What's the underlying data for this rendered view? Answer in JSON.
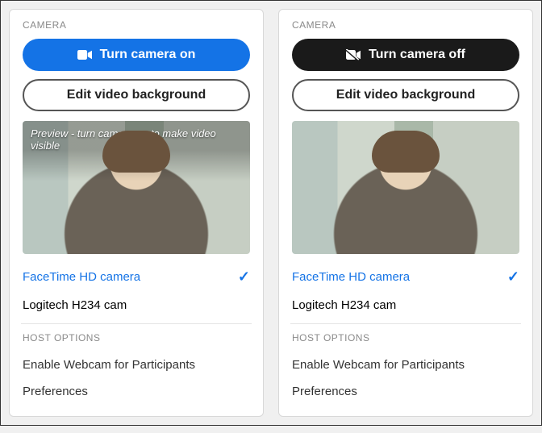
{
  "left": {
    "section_label": "CAMERA",
    "toggle_label": "Turn camera on",
    "toggle_style": "blue",
    "toggle_icon": "camera",
    "edit_bg_label": "Edit video background",
    "preview_caption": "Preview -  turn camera on to make video visible",
    "devices": [
      {
        "name": "FaceTime HD camera",
        "selected": true
      },
      {
        "name": "Logitech H234 cam",
        "selected": false
      }
    ],
    "host_section_label": "HOST OPTIONS",
    "host_options": [
      "Enable Webcam for Participants",
      "Preferences"
    ]
  },
  "right": {
    "section_label": "CAMERA",
    "toggle_label": "Turn camera off",
    "toggle_style": "dark",
    "toggle_icon": "camera-slash",
    "edit_bg_label": "Edit video background",
    "preview_caption": "",
    "devices": [
      {
        "name": "FaceTime HD camera",
        "selected": true
      },
      {
        "name": "Logitech H234 cam",
        "selected": false
      }
    ],
    "host_section_label": "HOST OPTIONS",
    "host_options": [
      "Enable Webcam for Participants",
      "Preferences"
    ]
  }
}
